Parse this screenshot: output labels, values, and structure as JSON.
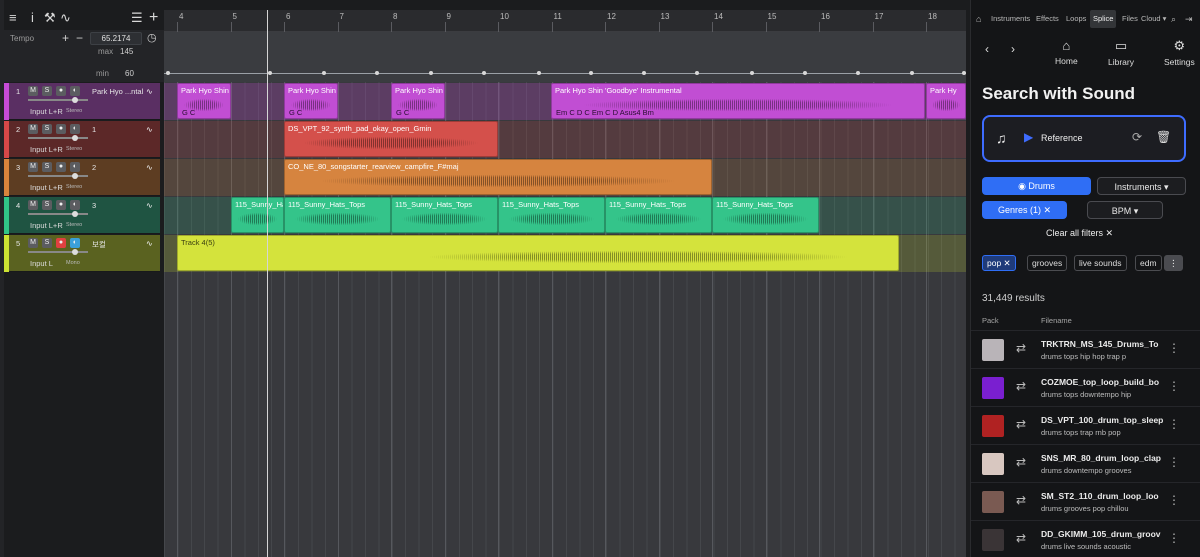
{
  "toolbar": {
    "menu": "≡",
    "info": "i",
    "tool": "⚒",
    "curve": "∿",
    "list": "☰",
    "add": "+"
  },
  "tempo": {
    "label": "Tempo",
    "plus": "+",
    "minus": "−",
    "value": "65.2174",
    "max_label": "max",
    "max": "145",
    "min_label": "min",
    "min": "60"
  },
  "ruler": [
    "4",
    "5",
    "6",
    "7",
    "8",
    "9",
    "10",
    "11",
    "12",
    "13",
    "14",
    "15",
    "16",
    "17",
    "18"
  ],
  "tracks": [
    {
      "num": "1",
      "name": "Park Hyo ...ntal",
      "input": "Input L+R",
      "mode": "Stereo",
      "color": "#c64bd7",
      "header": "#5a2f63"
    },
    {
      "num": "2",
      "name": "1",
      "input": "Input L+R",
      "mode": "Stereo",
      "color": "#d64848",
      "header": "#5c2828"
    },
    {
      "num": "3",
      "name": "2",
      "input": "Input L+R",
      "mode": "Stereo",
      "color": "#d9843c",
      "header": "#5d3d22"
    },
    {
      "num": "4",
      "name": "3",
      "input": "Input L+R",
      "mode": "Stereo",
      "color": "#31c487",
      "header": "#1f5442"
    },
    {
      "num": "5",
      "name": "보컬",
      "input": "Input L",
      "mode": "Mono",
      "color": "#cde233",
      "header": "#5a6220"
    }
  ],
  "buttons": {
    "m": "M",
    "s": "S"
  },
  "clips": {
    "t1": [
      "Park Hyo Shin",
      "Park Hyo Shin",
      "Park Hyo Shin",
      "Park Hyo Shin 'Goodbye' Instrumental",
      "Park Hy"
    ],
    "t1_chords": [
      "G  C",
      "G  C",
      "G  C",
      "Em   C   D   C   Em   C   D   Asus4  Bm"
    ],
    "t2": "DS_VPT_92_synth_pad_okay_open_Gmin",
    "t3": "CO_NE_80_songstarter_rearview_campfire_F#maj",
    "t4": [
      "115_Sunny_Ha",
      "115_Sunny_Hats_Tops",
      "115_Sunny_Hats_Tops",
      "115_Sunny_Hats_Tops",
      "115_Sunny_Hats_Tops",
      "115_Sunny_Hats_Tops"
    ],
    "t5": "Track 4(5)"
  },
  "panel": {
    "tabs": [
      "Instruments",
      "Effects",
      "Loops",
      "Splice",
      "Files",
      "Cloud ▾"
    ],
    "nav": [
      {
        "icon": "⌂",
        "label": "Home"
      },
      {
        "icon": "▭",
        "label": "Library"
      },
      {
        "icon": "⚙",
        "label": "Settings"
      }
    ],
    "title": "Search with Sound",
    "reference": "Reference",
    "drums": "Drums",
    "instruments": "Instruments",
    "genres": "Genres (1)",
    "bpm": "BPM",
    "clear": "Clear all filters",
    "chips": [
      "pop",
      "grooves",
      "live sounds",
      "edm"
    ],
    "results": "31,449 results",
    "col_pack": "Pack",
    "col_file": "Filename",
    "rows": [
      {
        "file": "TRKTRN_MS_145_Drums_To",
        "tags": "drums   tops   hip hop   trap   p",
        "thumb": "#b9b4b8"
      },
      {
        "file": "COZMOE_top_loop_build_bo",
        "tags": "drums   tops   downtempo   hip",
        "thumb": "#7a1fd0"
      },
      {
        "file": "DS_VPT_100_drum_top_sleep",
        "tags": "drums   tops   trap   rnb   pop",
        "thumb": "#b02222"
      },
      {
        "file": "SNS_MR_80_drum_loop_clap",
        "tags": "drums   downtempo   grooves",
        "thumb": "#d8c7c0"
      },
      {
        "file": "SM_ST2_110_drum_loop_loo",
        "tags": "drums   grooves   pop   chillou",
        "thumb": "#7a5a52"
      },
      {
        "file": "DD_GKIMM_105_drum_groov",
        "tags": "drums   live sounds   acoustic",
        "thumb": "#3a3436"
      }
    ]
  }
}
